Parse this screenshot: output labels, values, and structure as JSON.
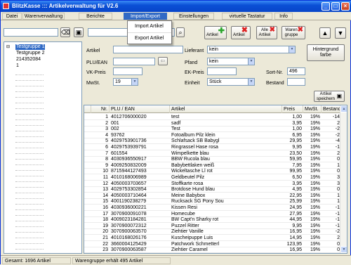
{
  "window": {
    "title": "BlitzKasse ::: Artikelverwaltung für V2.6"
  },
  "menu": [
    "Datei",
    "Warenverwaltung",
    "Berichte",
    "Import/Export",
    "Einstellungen",
    "virtuelle Tastatur",
    "Info"
  ],
  "import_export_menu": [
    "Import Artikel",
    "Export Artikel"
  ],
  "toolbar": {
    "search_value": "",
    "btn_artikel_add": "Artikel",
    "btn_artikel_delete": "Artikel",
    "btn_alle_artikel": "Alle Artikel",
    "btn_warengruppe": "Waren gruppe"
  },
  "tree": {
    "items": [
      "Testgruppe 1",
      "Testgruppe 2",
      "214352084",
      "1"
    ],
    "selected": "Testgruppe 1"
  },
  "form": {
    "artikel_label": "Artikel",
    "plu_label": "PLU/EAN",
    "vk_label": "VK-Preis",
    "mwst_label": "MwSt.",
    "mwst_value": "19",
    "lieferant_label": "Lieferant",
    "lieferant_value": "kein",
    "pfand_label": "Pfand",
    "pfand_value": "kein",
    "ek_label": "EK-Preis",
    "einheit_label": "Einheit",
    "einheit_value": "Stück",
    "sort_label": "Sort-Nr.",
    "sort_value": "496",
    "bestand_label": "Bestand",
    "bg_btn": "Hintergrund farbe",
    "save_btn": "Artikel speichern"
  },
  "table": {
    "headers": [
      "Nr.",
      "PLU / EAN",
      "Artikel",
      "Preis",
      "MwSt.",
      "Bestand"
    ],
    "rows": [
      [
        "1",
        "4012706000020",
        "test",
        "1,00",
        "19%",
        "-14"
      ],
      [
        "2",
        "001",
        "sadf",
        "3,95",
        "19%",
        "2"
      ],
      [
        "3",
        "002",
        "Test",
        "1,00",
        "19%",
        "-2"
      ],
      [
        "4",
        "93762",
        "Fotoalbum Pilz klein",
        "6,95",
        "19%",
        "-2"
      ],
      [
        "5",
        "4029753901736",
        "Schlafsack SB Babygl",
        "29,95",
        "19%",
        "-4"
      ],
      [
        "6",
        "4029753939791",
        "Ringrassel Hase rosa",
        "9,95",
        "19%",
        "-1"
      ],
      [
        "7",
        "601554",
        "Wimpelkette blau",
        "23,50",
        "19%",
        "2"
      ],
      [
        "8",
        "4030936550917",
        "BBW Rucola blau",
        "59,95",
        "19%",
        "0"
      ],
      [
        "9",
        "4009250832009",
        "Babybettlaken weiß",
        "7,95",
        "19%",
        "1"
      ],
      [
        "10",
        "8715944127493",
        "Wickeltasche Ll rot",
        "99,95",
        "19%",
        "0"
      ],
      [
        "11",
        "4010168006989",
        "Geldbeutel Pilz",
        "6,50",
        "19%",
        "3"
      ],
      [
        "12",
        "4050003703657",
        "Stoffkarte rosa",
        "3,95",
        "19%",
        "3"
      ],
      [
        "13",
        "4029753302854",
        "Brotdose Hund blau",
        "4,95",
        "19%",
        "0"
      ],
      [
        "14",
        "4050003710464",
        "Meine Babybox",
        "22,95",
        "19%",
        "1"
      ],
      [
        "15",
        "4001190238279",
        "Rucksack SG Pony Sou",
        "25,99",
        "19%",
        "1"
      ],
      [
        "16",
        "4030936000221",
        "Kissen Resi",
        "24,95",
        "19%",
        "-1"
      ],
      [
        "17",
        "3070900091078",
        "Homecube",
        "27,95",
        "19%",
        "-1"
      ],
      [
        "18",
        "4009023184281",
        "BW Capt'n Sharky rot",
        "44,95",
        "19%",
        "-1"
      ],
      [
        "19",
        "3070900072312",
        "Puzzel Ritter",
        "9,95",
        "19%",
        "-1"
      ],
      [
        "20",
        "3070900063570",
        "Ziehtier Vanille",
        "16,95",
        "19%",
        "-2"
      ],
      [
        "21",
        "4010168026176",
        "Kuscheipuppe Luis",
        "14,95",
        "19%",
        "2"
      ],
      [
        "22",
        "3660004125429",
        "Patchwork Schmetterl",
        "123,95",
        "19%",
        "0"
      ],
      [
        "23",
        "3070900063587",
        "Ziehtier Caramel",
        "16,95",
        "19%",
        "0"
      ]
    ]
  },
  "status": {
    "total": "Gesamt: 1696 Artikel",
    "group": "Warengruppe erhält 495 Artikel"
  },
  "colors": {
    "titlebar": "#0a4fd6",
    "selection": "#316ac5",
    "add": "#2aa52a",
    "delete": "#d22"
  }
}
